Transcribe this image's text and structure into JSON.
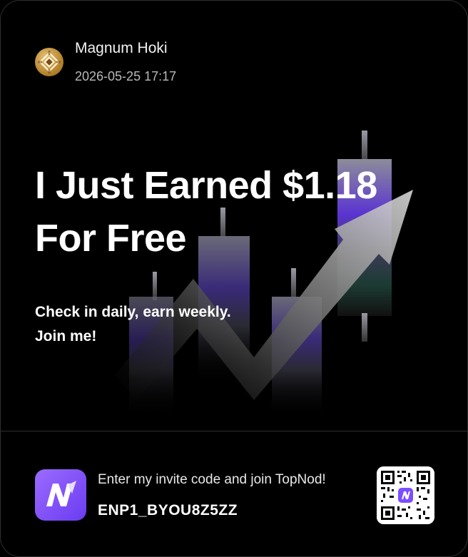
{
  "user": {
    "name": "Magnum Hoki",
    "timestamp": "2026-05-25 17:17"
  },
  "headline": {
    "line1": "I Just Earned $1.18",
    "line2": "For Free"
  },
  "subtitle": {
    "line1": "Check in daily, earn weekly.",
    "line2": "Join me!"
  },
  "invite": {
    "prompt": "Enter my invite code and join TopNod!",
    "code": "ENP1_BYOU8Z5ZZ"
  },
  "icons": {
    "avatar": "avatar-image",
    "app": "topnod-logo-icon",
    "qr": "qr-code"
  },
  "colors": {
    "background": "#000000",
    "accent": "#7b4dff",
    "text": "#ffffff",
    "muted": "#b9b9b9"
  }
}
